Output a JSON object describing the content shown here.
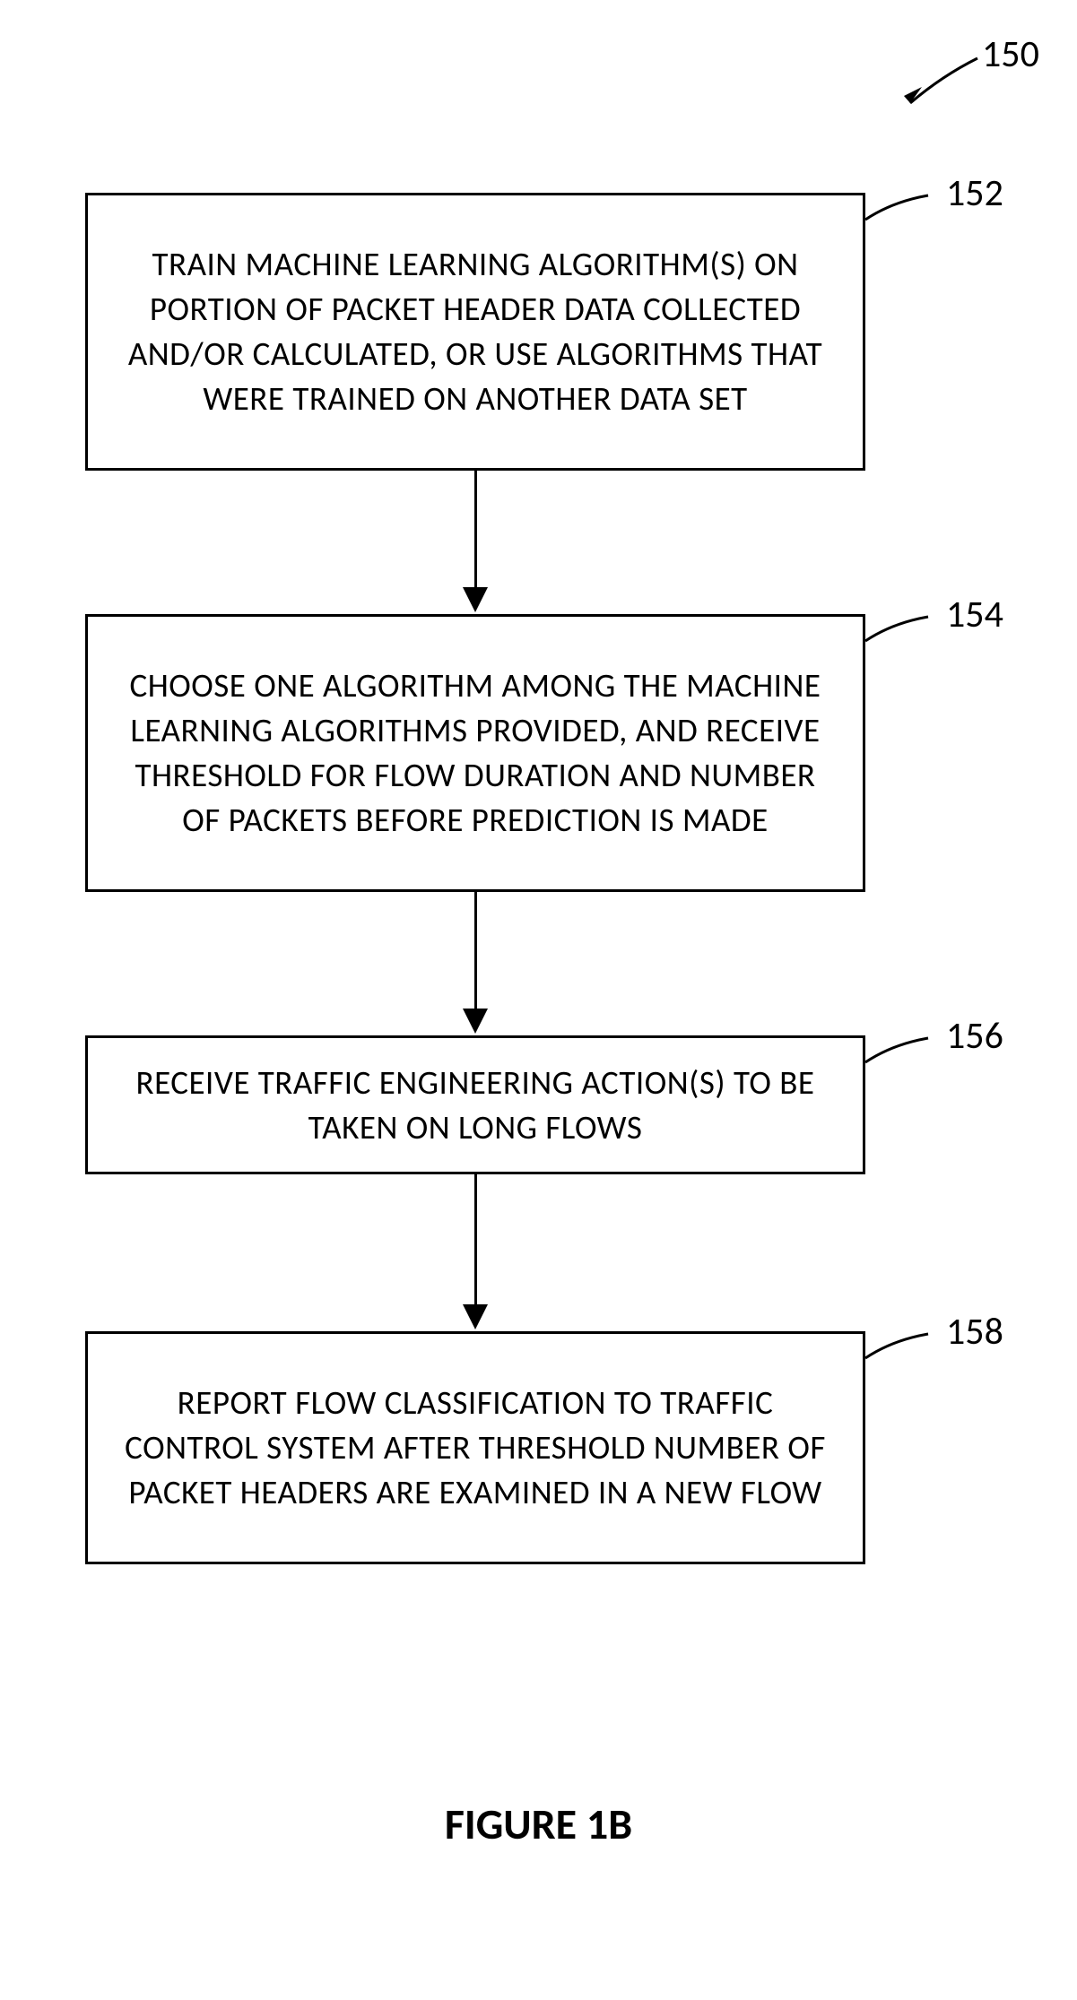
{
  "figure": {
    "number": "150",
    "title": "FIGURE 1B"
  },
  "steps": [
    {
      "id": "152",
      "text": "TRAIN MACHINE LEARNING ALGORITHM(S) ON PORTION OF PACKET HEADER DATA COLLECTED AND/OR CALCULATED, OR USE ALGORITHMS THAT WERE TRAINED ON ANOTHER DATA SET"
    },
    {
      "id": "154",
      "text": "CHOOSE ONE ALGORITHM AMONG THE MACHINE LEARNING ALGORITHMS PROVIDED, AND RECEIVE THRESHOLD FOR FLOW DURATION AND NUMBER OF PACKETS BEFORE PREDICTION IS MADE"
    },
    {
      "id": "156",
      "text": "RECEIVE TRAFFIC ENGINEERING ACTION(S) TO BE TAKEN ON LONG FLOWS"
    },
    {
      "id": "158",
      "text": "REPORT FLOW CLASSIFICATION TO TRAFFIC CONTROL SYSTEM AFTER THRESHOLD NUMBER OF PACKET HEADERS ARE EXAMINED IN A NEW FLOW"
    }
  ]
}
